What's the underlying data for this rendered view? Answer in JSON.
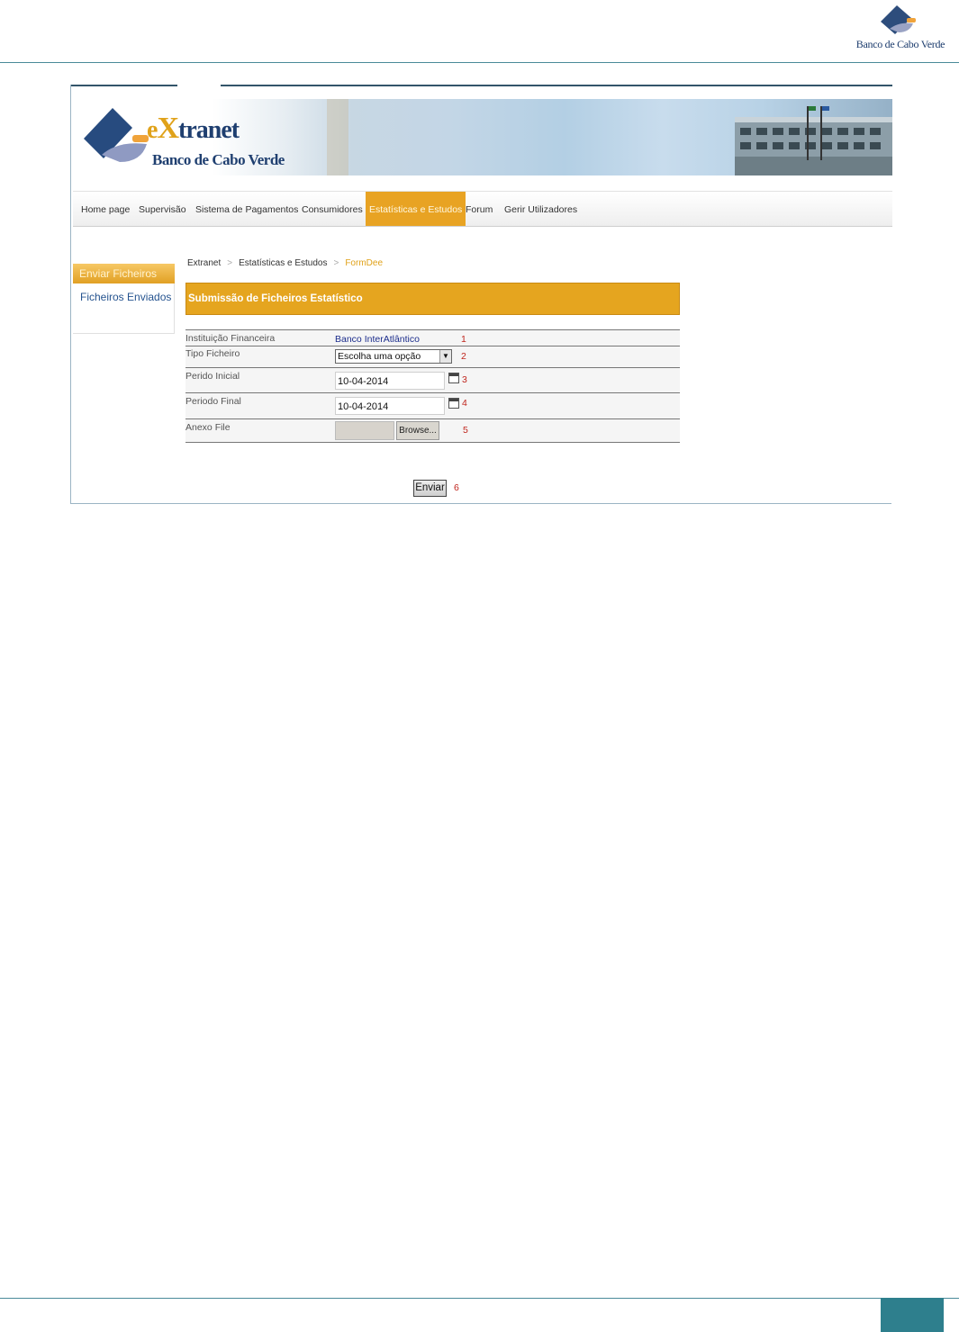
{
  "document": {
    "logo_text": "Banco de Cabo Verde"
  },
  "banner": {
    "title_e": "e",
    "title_x": "X",
    "title_rest": "tranet",
    "bank_name": "Banco de Cabo Verde"
  },
  "nav": {
    "items": [
      {
        "label": "Home page",
        "active": false
      },
      {
        "label": "Supervisão",
        "active": false
      },
      {
        "label": "Sistema de Pagamentos",
        "active": false
      },
      {
        "label": "Consumidores",
        "active": false
      },
      {
        "label": "Estatísticas e Estudos",
        "active": true
      },
      {
        "label": "Forum",
        "active": false
      },
      {
        "label": "Gerir Utilizadores",
        "active": false
      }
    ]
  },
  "sidebar": {
    "items": [
      {
        "label": "Enviar Ficheiros",
        "active": true
      },
      {
        "label": "Ficheiros Enviados",
        "active": false
      }
    ]
  },
  "breadcrumb": {
    "items": [
      "Extranet",
      "Estatísticas e Estudos",
      "FormDee"
    ],
    "separator": ">"
  },
  "form": {
    "title": "Submissão de Ficheiros Estatístico",
    "fields": [
      {
        "label": "Instituição Financeira",
        "value": "Banco InterAtlântico",
        "marker": "1"
      },
      {
        "label": "Tipo Ficheiro",
        "value": "Escolha uma opção",
        "marker": "2"
      },
      {
        "label": "Perido Inicial",
        "value": "10-04-2014",
        "marker": "3"
      },
      {
        "label": "Periodo Final",
        "value": "10-04-2014",
        "marker": "4"
      },
      {
        "label": "Anexo File",
        "value": "",
        "marker": "5"
      }
    ],
    "browse_label": "Browse...",
    "submit_label": "Enviar",
    "submit_marker": "6"
  },
  "colors": {
    "accent": "#e5a51f",
    "brand_blue": "#1f3f70",
    "marker_red": "#c0261e",
    "footer_teal": "#2e7f8d"
  }
}
